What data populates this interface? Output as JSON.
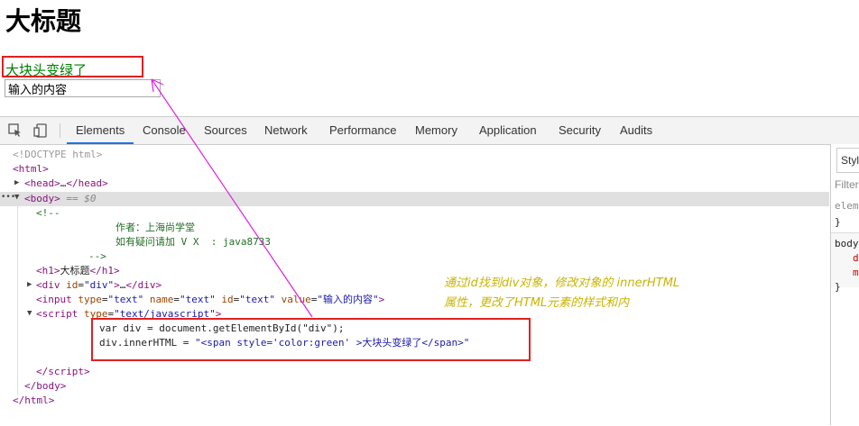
{
  "page": {
    "heading": "大标题",
    "div_text": "大块头变绿了",
    "input_value": "输入的内容"
  },
  "devtools": {
    "tabs": [
      "Elements",
      "Console",
      "Sources",
      "Network",
      "Performance",
      "Memory",
      "Application",
      "Security",
      "Audits"
    ],
    "active_tab": "Elements",
    "dom": {
      "doctype": "<!DOCTYPE html>",
      "html_open_tag": "html",
      "head_tag": "head",
      "ellipsis": "…",
      "body_tag": "body",
      "body_selected_marker": "== $0",
      "comment_open": "<!--",
      "comment_author": "作者：上海尚学堂",
      "comment_contact": "如有疑问请加 V X  : java8733",
      "comment_close": "-->",
      "h1_tag": "h1",
      "h1_text": "大标题",
      "div_tag": "div",
      "div_attr_name": "id",
      "div_attr_value": "\"div\"",
      "input_tag": "input",
      "input_attrs": [
        {
          "name": "type",
          "value": "\"text\""
        },
        {
          "name": "name",
          "value": "\"text\""
        },
        {
          "name": "id",
          "value": "\"text\""
        },
        {
          "name": "value",
          "value": "\"输入的内容\""
        }
      ],
      "script_tag": "script",
      "script_attr_name": "type",
      "script_attr_value": "\"text/javascript\"",
      "js_line1": "var div = document.getElementById(\"div\");",
      "js_line2_prefix": "div.innerHTML = ",
      "js_line2_string": "\"<span style='color:green' >大块头变绿了</span>\"",
      "script_close": "script",
      "body_close": "body",
      "html_close": "html"
    },
    "styles": {
      "tab_label": "Styl",
      "filter_label": "Filter",
      "elem_label": "elem",
      "brace_close": "}",
      "body_selector": "body",
      "prop1": "d",
      "prop2": "m"
    }
  },
  "annotation": {
    "line1": "通过id找到div对象，修改对象的 innerHTML",
    "line2": "属性，更改了HTML元素的样式和内"
  },
  "colors": {
    "annotation": "#c8b400",
    "highlight_box": "#e02020",
    "arrow": "#e020e0",
    "green_text": "#008000"
  }
}
